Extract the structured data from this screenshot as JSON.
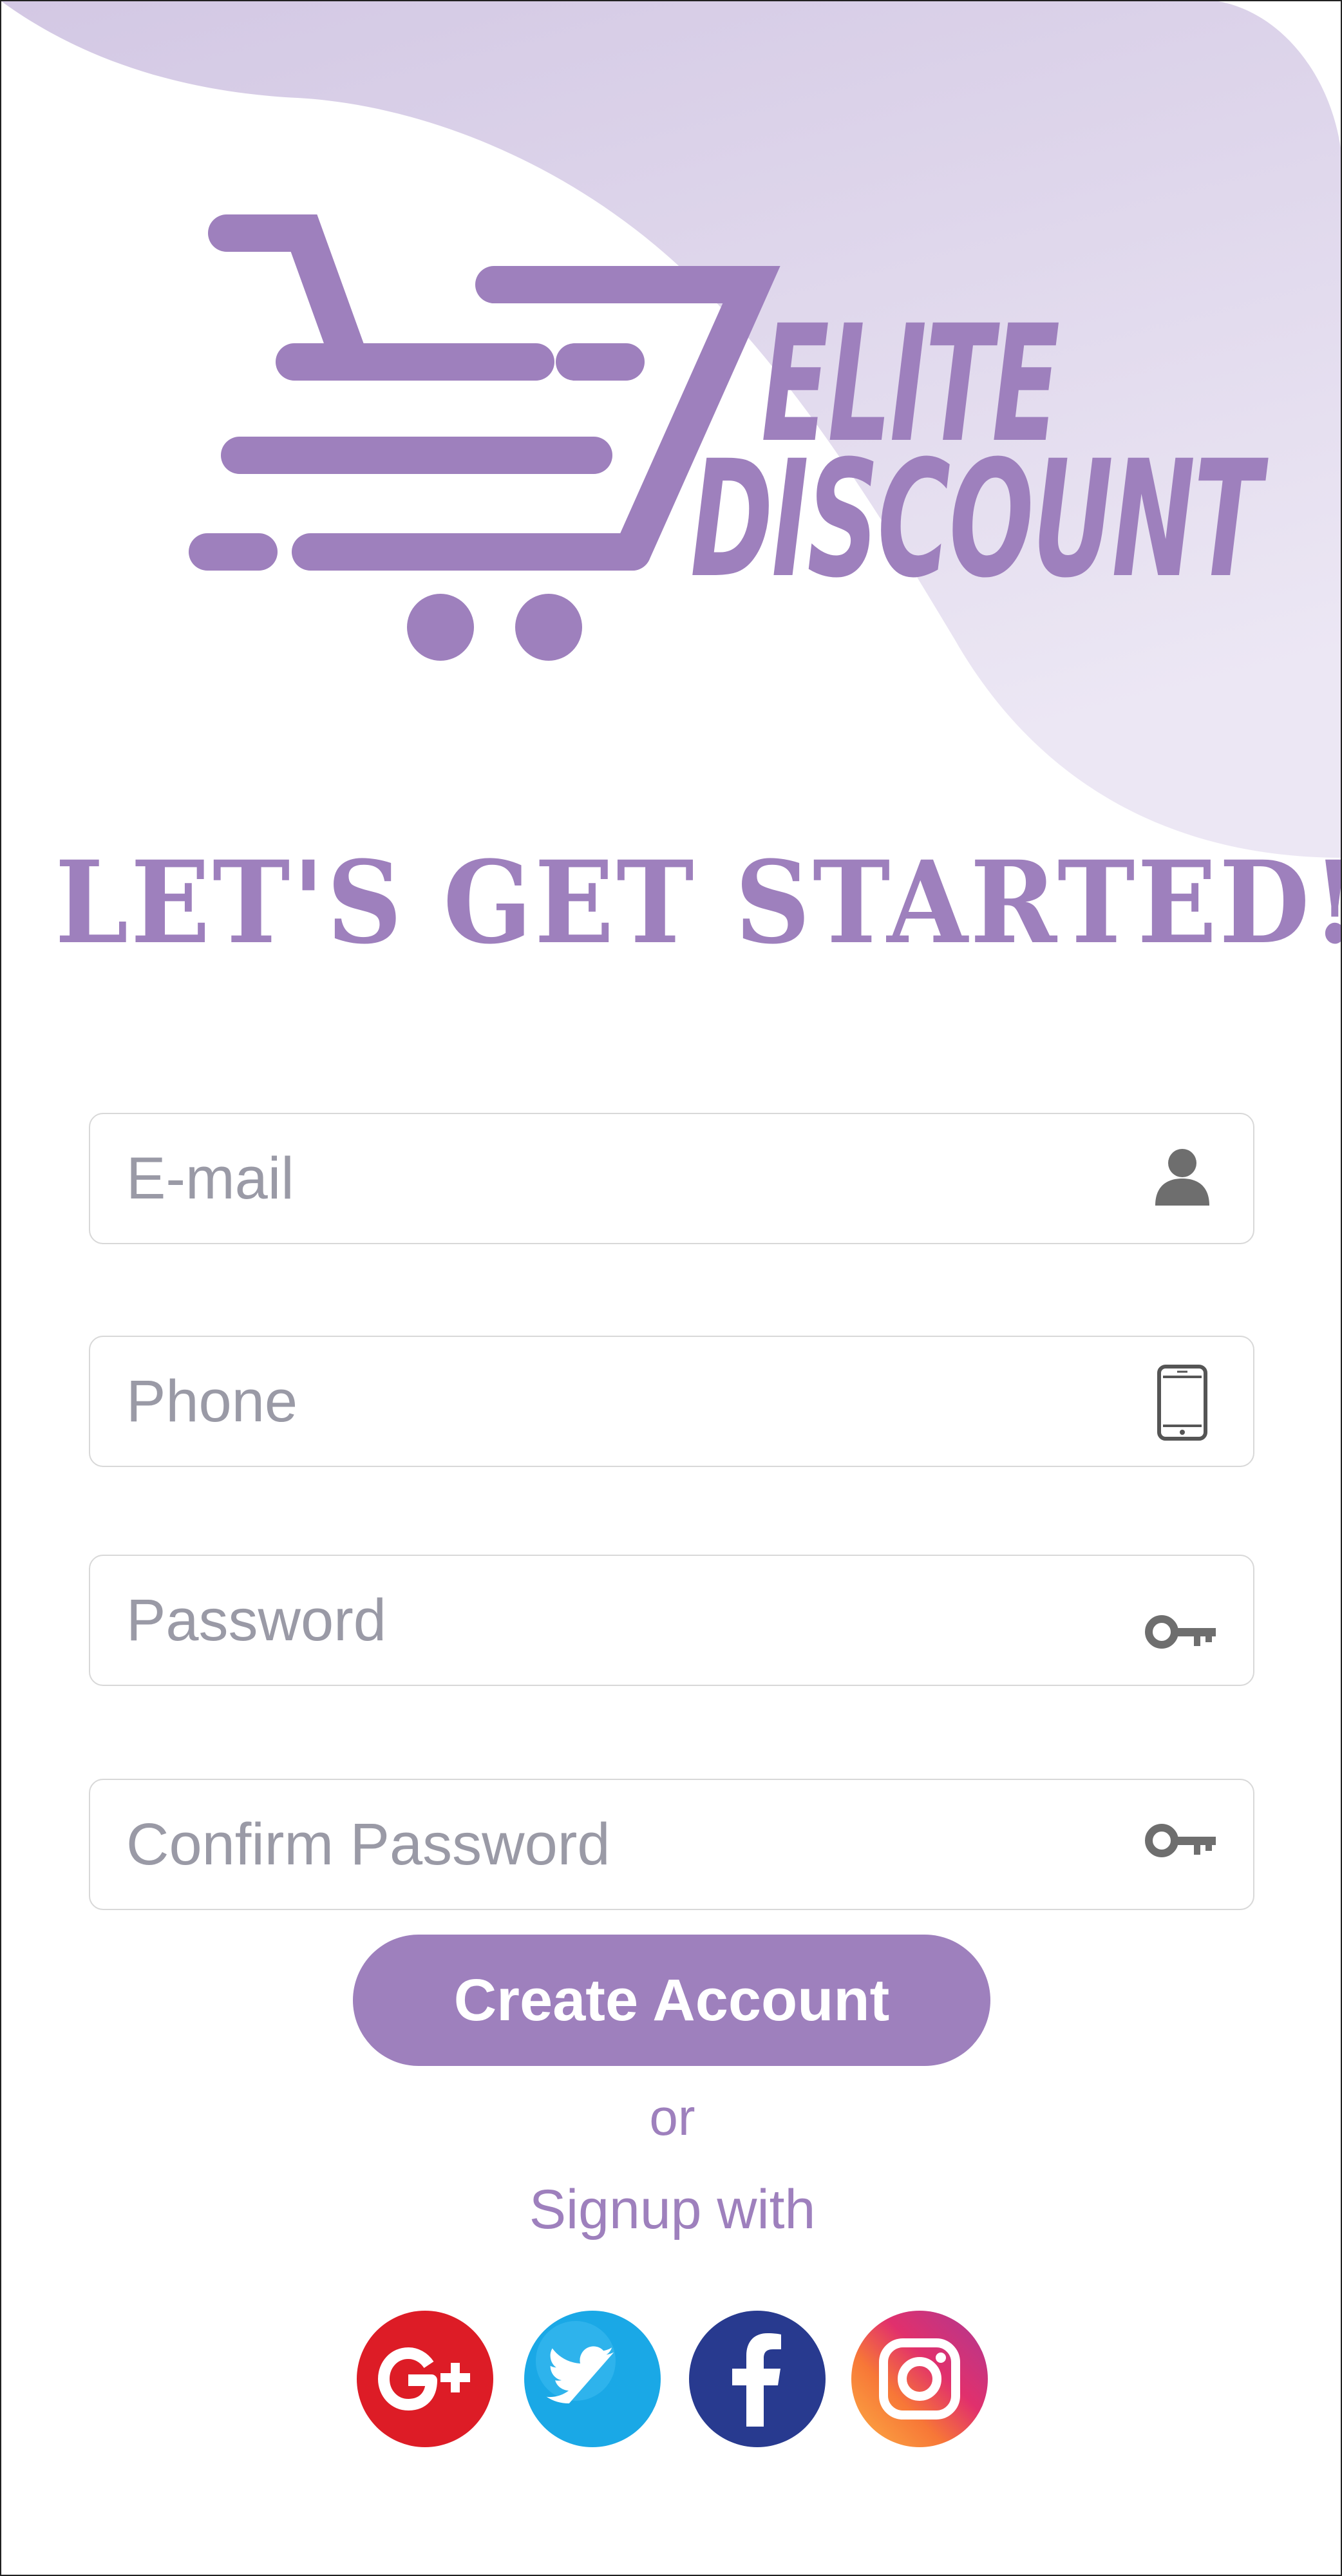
{
  "brand": {
    "line1": "ELITE",
    "line2": "DISCOUNT",
    "logo_icon": "shopping-cart-icon",
    "accent_color": "#9e80bd",
    "blob_color": "#d6cbe6"
  },
  "headline": "LET'S GET STARTED!!",
  "form": {
    "email": {
      "placeholder": "E-mail",
      "value": "",
      "icon": "user-icon"
    },
    "phone": {
      "placeholder": "Phone",
      "value": "",
      "icon": "smartphone-icon"
    },
    "password": {
      "placeholder": "Password",
      "value": "",
      "icon": "key-icon"
    },
    "confirm_password": {
      "placeholder": "Confirm Password",
      "value": "",
      "icon": "key-icon"
    },
    "submit_label": "Create Account"
  },
  "divider_text": "or",
  "signup_with": "Signup with",
  "social": [
    {
      "name": "Google Plus",
      "icon": "google-plus-icon",
      "color": "#dd1c26"
    },
    {
      "name": "Twitter",
      "icon": "twitter-icon",
      "color": "#1da1f2"
    },
    {
      "name": "Facebook",
      "icon": "facebook-icon",
      "color": "#283a8f"
    },
    {
      "name": "Instagram",
      "icon": "instagram-icon",
      "color": "#e1306c"
    }
  ]
}
